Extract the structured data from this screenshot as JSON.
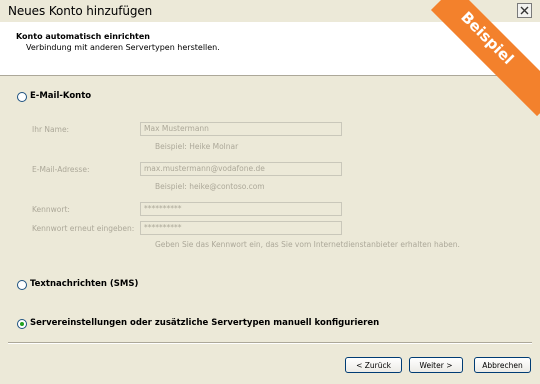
{
  "window": {
    "title": "Neues Konto hinzufügen"
  },
  "badge": {
    "text": "Beispiel"
  },
  "header": {
    "title": "Konto automatisch einrichten",
    "subtitle": "Verbindung mit anderen Servertypen herstellen."
  },
  "options": {
    "email": {
      "label": "E-Mail-Konto",
      "checked": false
    },
    "sms": {
      "label": "Textnachrichten (SMS)",
      "checked": false
    },
    "manual": {
      "label": "Servereinstellungen oder zusätzliche Servertypen manuell konfigurieren",
      "checked": true
    }
  },
  "form": {
    "name_label": "Ihr Name:",
    "name_value": "Max Mustermann",
    "name_hint": "Beispiel: Heike Molnar",
    "email_label": "E-Mail-Adresse:",
    "email_value": "max.mustermann@vodafone.de",
    "email_hint": "Beispiel: heike@contoso.com",
    "pw_label": "Kennwort:",
    "pw_value": "**********",
    "pw2_label": "Kennwort erneut eingeben:",
    "pw2_value": "**********",
    "pw_hint": "Geben Sie das Kennwort ein, das Sie vom Internetdienstanbieter erhalten haben."
  },
  "buttons": {
    "back": "< Zurück",
    "next": "Weiter >",
    "cancel": "Abbrechen"
  },
  "colors": {
    "accent": "#f3812c",
    "radio_dot": "#21a121",
    "dialog_bg": "#ece9d8"
  }
}
